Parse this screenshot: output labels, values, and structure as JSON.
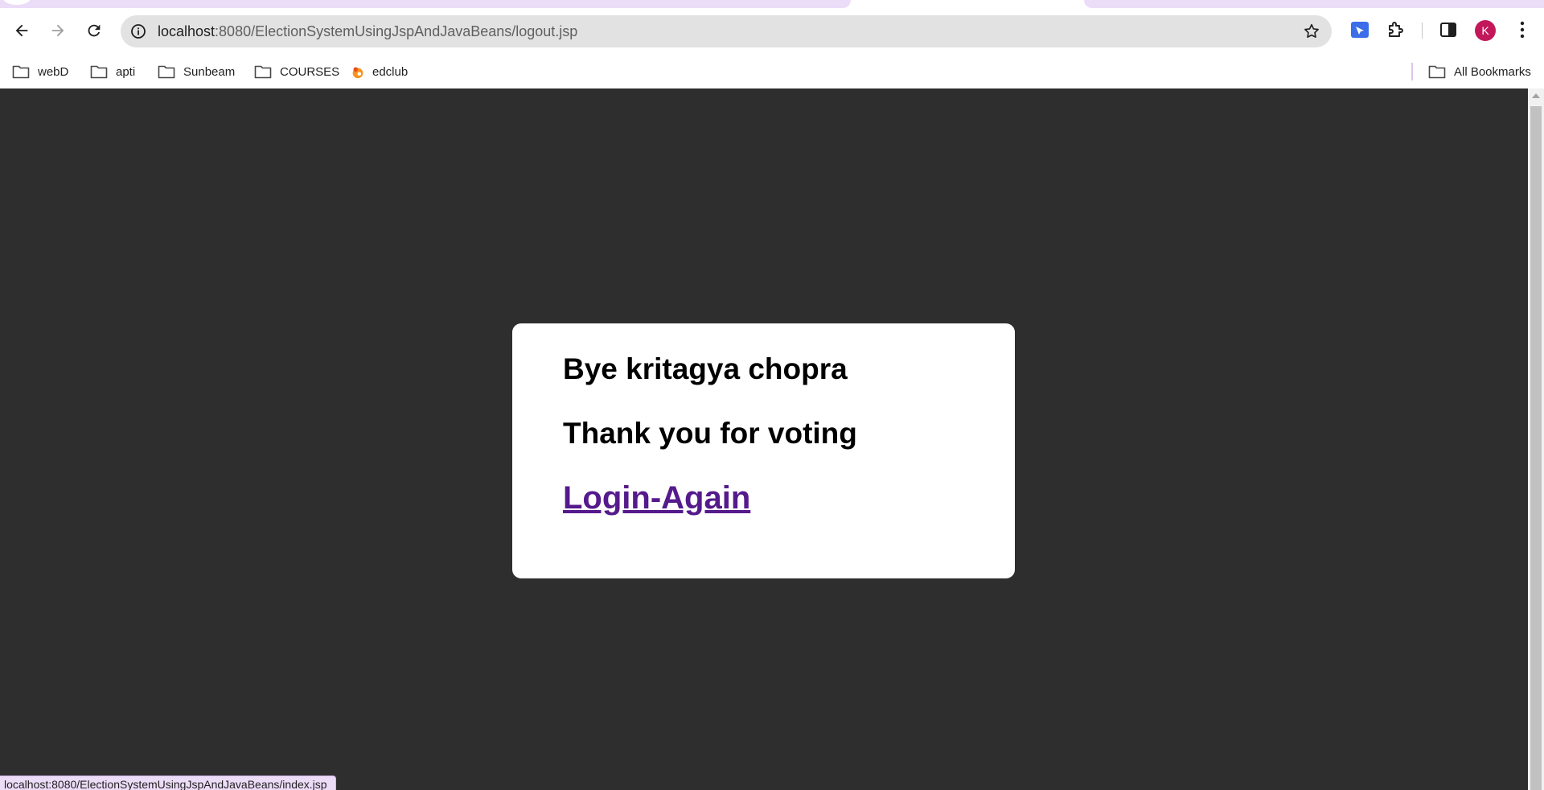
{
  "browser": {
    "url_host": "localhost",
    "url_rest": ":8080/ElectionSystemUsingJspAndJavaBeans/logout.jsp",
    "profile_initial": "K",
    "bookmarks": [
      "webD",
      "apti",
      "Sunbeam",
      "COURSES",
      "edclub"
    ],
    "all_bookmarks_label": "All Bookmarks",
    "status_url": "localhost:8080/ElectionSystemUsingJspAndJavaBeans/index.jsp"
  },
  "page": {
    "bye_text": "Bye kritagya chopra",
    "thanks_text": "Thank you for voting",
    "login_link": "Login-Again"
  },
  "colors": {
    "page_bg": "#2e2e2e",
    "card_bg": "#ffffff",
    "link": "#551a8b",
    "tab_strip": "#ebdcf7",
    "avatar": "#c2185b"
  }
}
